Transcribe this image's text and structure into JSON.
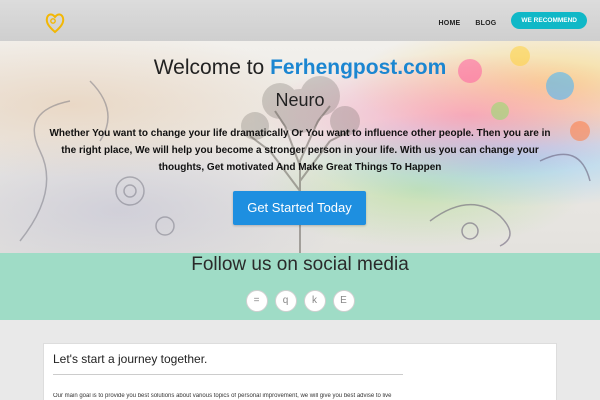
{
  "nav": {
    "logo_icon": "heart-bulb-logo",
    "items": [
      {
        "label": "HOME"
      },
      {
        "label": "BLOG"
      }
    ],
    "cta_label": "WE RECOMMEND",
    "accent": "#10b8c7"
  },
  "hero": {
    "title_prefix": "Welcome to",
    "title_brand": "Ferhengpost.com",
    "subtitle": "Neuro",
    "text": "Whether You want to change your life dramatically Or You want to influence other people. Then you are in the right place, We will help you become a stronger person in your life. With us you can change your thoughts, Get motivated And Make Great Things To Happen",
    "button_label": "Get Started Today",
    "brand_color": "#1b86d1",
    "button_color": "#1e8fe0"
  },
  "social": {
    "title": "Follow us on social media",
    "icons": [
      {
        "glyph": "=",
        "name": "social-icon-1"
      },
      {
        "glyph": "q",
        "name": "social-icon-2"
      },
      {
        "glyph": "k",
        "name": "social-icon-3"
      },
      {
        "glyph": "E",
        "name": "social-icon-4"
      }
    ],
    "band_color": "#9fdcc6"
  },
  "card": {
    "title": "Let's start a journey together.",
    "text": "Our main goal is to provide you best solutions about various topics of personal improvement, we will give you best advise to live"
  }
}
